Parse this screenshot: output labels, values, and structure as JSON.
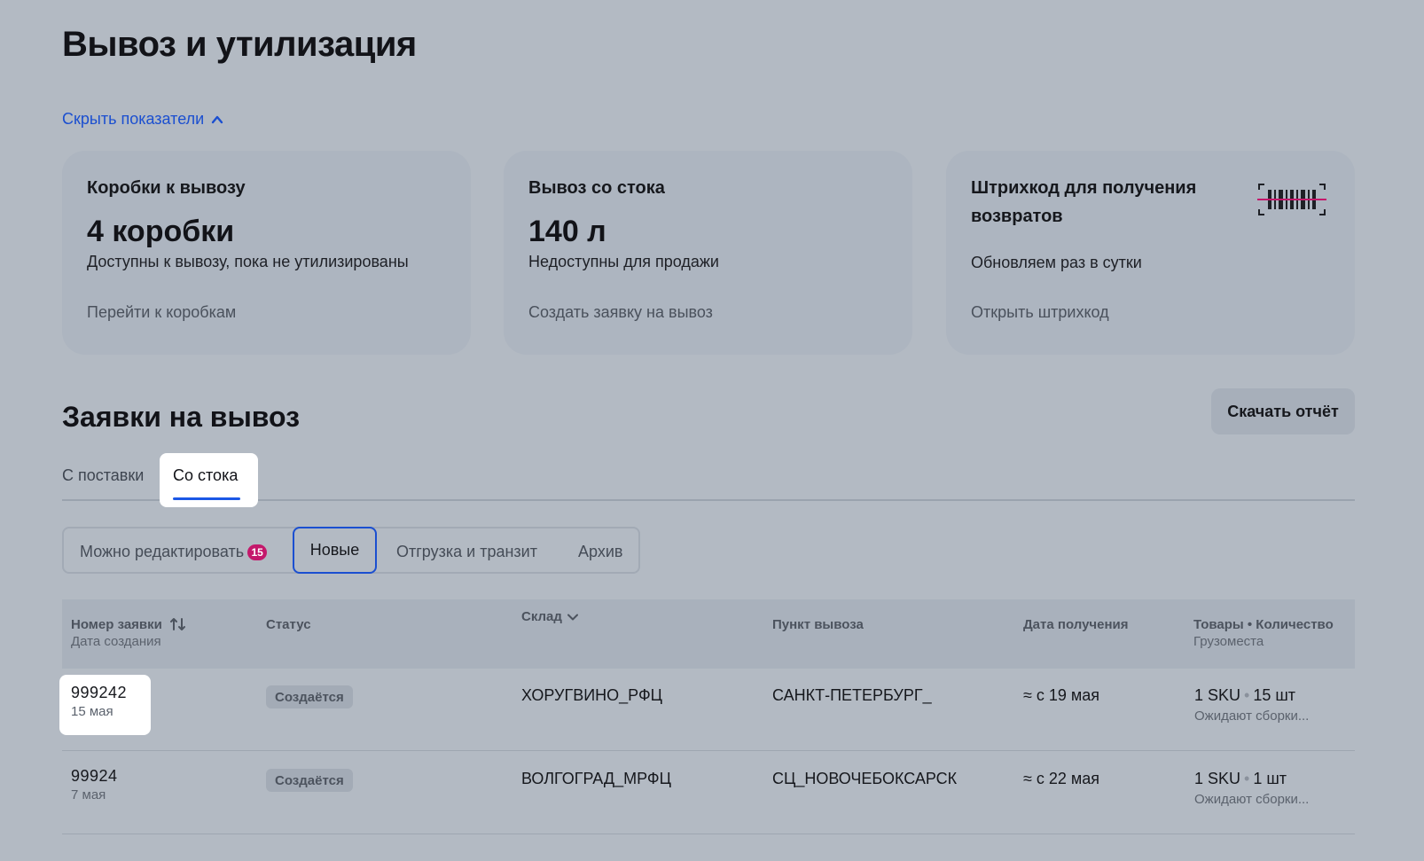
{
  "page": {
    "title": "Вывоз и утилизация"
  },
  "toggle": {
    "label": "Скрыть показатели"
  },
  "cards": [
    {
      "title": "Коробки к вывозу",
      "value": "4 коробки",
      "description": "Доступны к вывозу, пока не утилизированы",
      "link": "Перейти к коробкам"
    },
    {
      "title": "Вывоз со стока",
      "value": "140 л",
      "description": "Недоступны для продажи",
      "link": "Создать заявку на вывоз"
    },
    {
      "title": "Штрихкод для получения возвратов",
      "description": "Обновляем раз в сутки",
      "link": "Открыть штрихкод",
      "icon": "barcode-icon"
    }
  ],
  "requests": {
    "title": "Заявки на вывоз",
    "download_label": "Скачать отчёт",
    "tabs": [
      {
        "label": "С поставки"
      },
      {
        "label": "Со стока",
        "active": true
      }
    ],
    "filters": {
      "editable": "Можно редактировать",
      "editable_count": "15",
      "new": "Новые",
      "shipping": "Отгрузка и транзит",
      "archive": "Архив"
    },
    "columns": {
      "number": "Номер заявки",
      "created": "Дата создания",
      "status": "Статус",
      "warehouse": "Склад",
      "point": "Пункт вывоза",
      "date": "Дата получения",
      "goods": "Товары • Количество",
      "places": "Грузоместа"
    },
    "rows": [
      {
        "number": "999242",
        "created": "15 мая",
        "status": "Создаётся",
        "warehouse": "ХОРУГВИНО_РФЦ",
        "point": "САНКТ-ПЕТЕРБУРГ_",
        "date": "≈ с 19 мая",
        "sku": "1 SKU",
        "qty": "15 шт",
        "places": "Ожидают сборки..."
      },
      {
        "number": "99924",
        "created": "7 мая",
        "status": "Создаётся",
        "warehouse": "ВОЛГОГРАД_МРФЦ",
        "point": "СЦ_НОВОЧЕБОКСАРСК",
        "date": "≈ с 22 мая",
        "sku": "1 SKU",
        "qty": "1 шт",
        "places": "Ожидают сборки..."
      }
    ]
  },
  "colors": {
    "background": "#b3bac3",
    "accent": "#1b4fd0",
    "badge": "#c4186b",
    "card": "#adb5c0"
  }
}
